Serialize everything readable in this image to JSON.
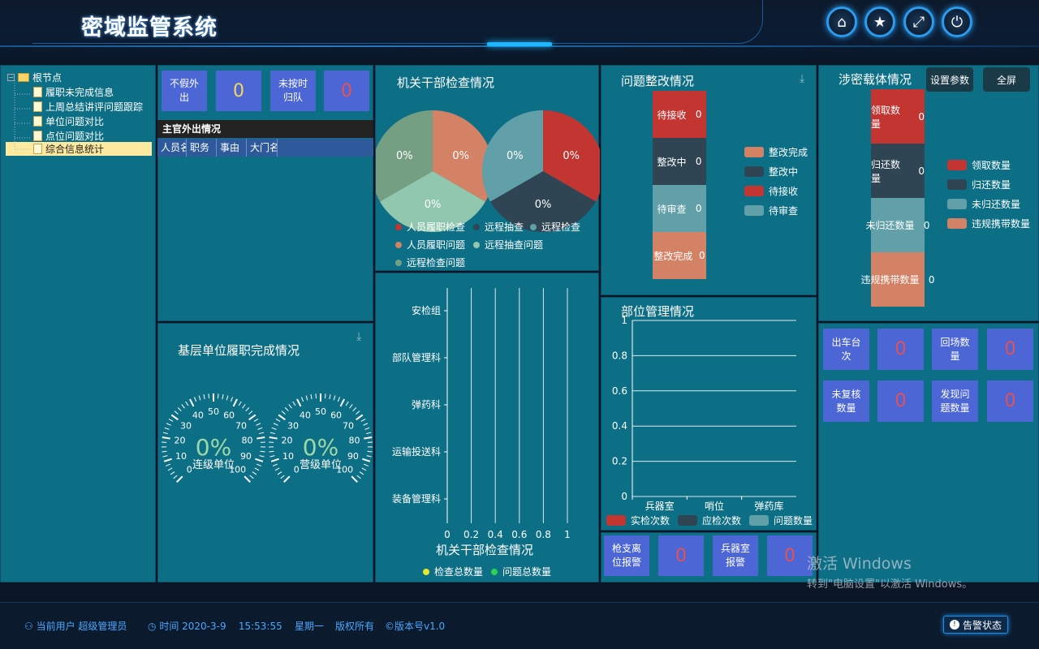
{
  "header": {
    "title": "密域监管系统"
  },
  "header_buttons": [
    {
      "name": "home-icon",
      "glyph": "⌂"
    },
    {
      "name": "star-icon",
      "glyph": "★"
    },
    {
      "name": "fullscreen-icon",
      "glyph": "⤢"
    },
    {
      "name": "power-icon",
      "glyph": "⏻"
    }
  ],
  "tree": {
    "root": "根节点",
    "items": [
      "履职未完成信息",
      "上周总结讲评问题跟踪",
      "单位问题对比",
      "点位问题对比",
      "综合信息统计"
    ],
    "selected_index": 4
  },
  "stats_top": {
    "box1_label": "不假外出",
    "box1_value": "0",
    "box2_label": "未按时归队",
    "box2_value": "0"
  },
  "leader_table": {
    "title": "主官外出情况",
    "columns": [
      "人员名",
      "职务",
      "事由",
      "大门名"
    ]
  },
  "gauges": {
    "title": "基层单位履职完成情况",
    "items": [
      {
        "label": "连级单位",
        "value": "0%"
      },
      {
        "label": "营级单位",
        "value": "0%"
      }
    ],
    "ticks": [
      "0",
      "10",
      "20",
      "30",
      "40",
      "50",
      "60",
      "70",
      "80",
      "90",
      "100"
    ]
  },
  "org_check": {
    "title": "机关干部检查情况",
    "pie_labels": [
      "0%",
      "0%",
      "0%",
      "0%",
      "0%",
      "0%"
    ],
    "legend": [
      {
        "label": "人员履职检查",
        "color": "#c23531"
      },
      {
        "label": "远程抽查",
        "color": "#2f4554"
      },
      {
        "label": "远程检查",
        "color": "#61a0a8"
      },
      {
        "label": "人员履职问题",
        "color": "#d48265"
      },
      {
        "label": "远程抽查问题",
        "color": "#91c7ae"
      },
      {
        "label": "远程检查问题",
        "color": "#749f83"
      }
    ]
  },
  "bar_check": {
    "title": "机关干部检查情况",
    "categories": [
      "安检组",
      "部队管理科",
      "弹药科",
      "运输投送科",
      "装备管理科"
    ],
    "x_ticks": [
      "0",
      "0.2",
      "0.4",
      "0.6",
      "0.8",
      "1"
    ],
    "legend": [
      {
        "label": "检查总数量",
        "color": "#e8e82a"
      },
      {
        "label": "问题总数量",
        "color": "#2dd14f"
      }
    ]
  },
  "rectify": {
    "title": "问题整改情况",
    "segments": [
      {
        "label": "待接收",
        "value": "0",
        "color": "#c23531"
      },
      {
        "label": "整改中",
        "value": "0",
        "color": "#2f4554"
      },
      {
        "label": "待审查",
        "value": "0",
        "color": "#61a0a8"
      },
      {
        "label": "整改完成",
        "value": "0",
        "color": "#d48265"
      }
    ],
    "legend": [
      {
        "label": "整改完成",
        "color": "#d48265"
      },
      {
        "label": "整改中",
        "color": "#2f4554"
      },
      {
        "label": "待接收",
        "color": "#c23531"
      },
      {
        "label": "待审查",
        "color": "#61a0a8"
      }
    ]
  },
  "site_mgmt": {
    "title": "部位管理情况",
    "y_ticks": [
      "0",
      "0.2",
      "0.4",
      "0.6",
      "0.8",
      "1"
    ],
    "categories": [
      "兵器室",
      "哨位",
      "弹药库"
    ],
    "legend": [
      {
        "label": "实检次数",
        "color": "#c23531"
      },
      {
        "label": "应检次数",
        "color": "#2f4554"
      },
      {
        "label": "问题数量",
        "color": "#61a0a8"
      }
    ]
  },
  "carrier": {
    "title": "涉密载体情况",
    "btn_params": "设置参数",
    "btn_full": "全屏",
    "segments": [
      {
        "label": "领取数量",
        "value": "0",
        "color": "#c23531"
      },
      {
        "label": "归还数量",
        "value": "0",
        "color": "#2f4554"
      },
      {
        "label": "未归还数量",
        "value": "0",
        "color": "#61a0a8"
      },
      {
        "label": "违规携带数量",
        "value": "0",
        "color": "#d48265"
      }
    ],
    "legend": [
      {
        "label": "领取数量",
        "color": "#c23531"
      },
      {
        "label": "归还数量",
        "color": "#2f4554"
      },
      {
        "label": "未归还数量",
        "color": "#61a0a8"
      },
      {
        "label": "违规携带数量",
        "color": "#d48265"
      }
    ]
  },
  "vehicle_stats": [
    {
      "label": "出车台次",
      "value": "0"
    },
    {
      "label": "回场数量",
      "value": "0"
    },
    {
      "label": "未复核数量",
      "value": "0"
    },
    {
      "label": "发现问题数量",
      "value": "0"
    }
  ],
  "alarm_stats": [
    {
      "label": "枪支离位报警",
      "value": "0"
    },
    {
      "label": "兵器室报警",
      "value": "0"
    }
  ],
  "footer": {
    "user": "当前用户 超级管理员",
    "time": "时间 2020-3-9    15:53:55    星期一",
    "copyright": "版权所有",
    "version": "©版本号v1.0",
    "alarm_btn": "告警状态"
  },
  "watermark": {
    "line1": "激活 Windows",
    "line2": "转到\"电脑设置\"以激活 Windows。"
  }
}
